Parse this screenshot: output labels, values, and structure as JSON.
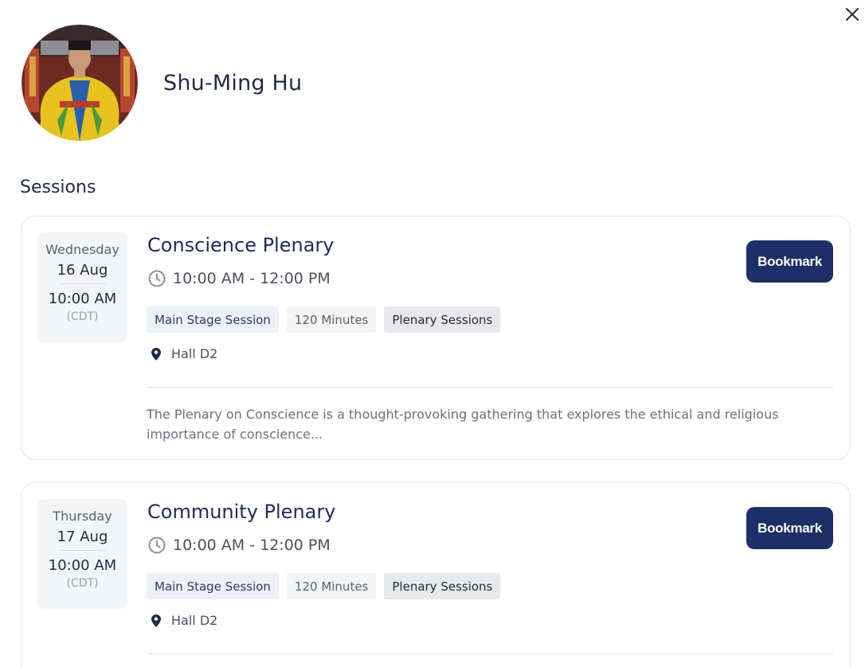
{
  "speaker": {
    "name": "Shu-Ming Hu",
    "avatar_icon": "speaker-portrait"
  },
  "close_icon": "close-icon",
  "sessions_heading": "Sessions",
  "colors": {
    "accent": "#1c2f66",
    "title": "#1f2a5a",
    "card_border": "#e3e6ec"
  },
  "sessions": [
    {
      "day": "Wednesday",
      "date": "16 Aug",
      "start_time": "10:00 AM",
      "timezone": "(CDT)",
      "title": "Conscience Plenary",
      "time_range": "10:00 AM - 12:00 PM",
      "bookmark_label": "Bookmark",
      "tags": {
        "type": "Main Stage Session",
        "duration": "120 Minutes",
        "track": "Plenary Sessions"
      },
      "location": "Hall D2",
      "description": "The Plenary on Conscience is a thought-provoking gathering that explores the ethical and religious importance of conscience..."
    },
    {
      "day": "Thursday",
      "date": "17 Aug",
      "start_time": "10:00 AM",
      "timezone": "(CDT)",
      "title": "Community Plenary",
      "time_range": "10:00 AM - 12:00 PM",
      "bookmark_label": "Bookmark",
      "tags": {
        "type": "Main Stage Session",
        "duration": "120 Minutes",
        "track": "Plenary Sessions"
      },
      "location": "Hall D2"
    }
  ]
}
